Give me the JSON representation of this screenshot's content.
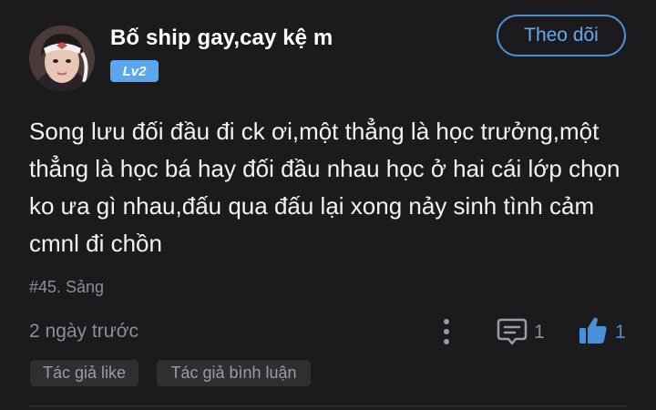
{
  "post": {
    "username": "Bố ship gay,cay kệ m",
    "level_badge": "Lv2",
    "follow_label": "Theo dõi",
    "content": "Song lưu đối đầu đi ck ơi,một thẳng là học trưởng,một thẳng là học bá hay đối đầu nhau học ở hai cái lớp chọn ko ưa gì nhau,đấu qua đấu lại xong nảy sinh tình cảm cmnl đi chồn",
    "tag": "#45. Sảng",
    "timestamp": "2 ngày trước",
    "comment_count": "1",
    "like_count": "1",
    "chips": [
      "Tác giả like",
      "Tác giả bình luận"
    ]
  },
  "icons": {
    "more": "more-vertical-icon",
    "comment": "comment-icon",
    "like": "thumbs-up-icon"
  },
  "colors": {
    "background": "#1b1b1d",
    "accent": "#4a90d9",
    "badge": "#5aa7f0",
    "muted_text": "#8e8e93"
  }
}
